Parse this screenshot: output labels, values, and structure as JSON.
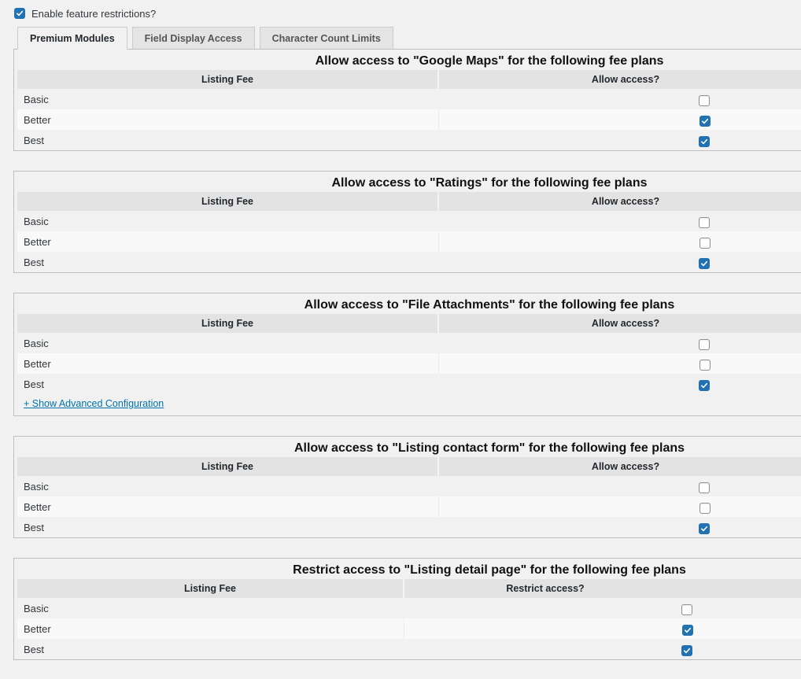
{
  "top_option": {
    "label": "Enable feature restrictions?",
    "checked": true
  },
  "tabs": [
    {
      "label": "Premium Modules",
      "active": true
    },
    {
      "label": "Field Display Access",
      "active": false
    },
    {
      "label": "Character Count Limits",
      "active": false
    }
  ],
  "panels": [
    {
      "title": "Allow access to \"Google Maps\" for the following fee plans",
      "col1": "Listing Fee",
      "col2": "Allow access?",
      "rows": [
        {
          "label": "Basic",
          "checked": false
        },
        {
          "label": "Better",
          "checked": true
        },
        {
          "label": "Best",
          "checked": true
        }
      ]
    },
    {
      "title": "Allow access to \"Ratings\" for the following fee plans",
      "col1": "Listing Fee",
      "col2": "Allow access?",
      "rows": [
        {
          "label": "Basic",
          "checked": false
        },
        {
          "label": "Better",
          "checked": false
        },
        {
          "label": "Best",
          "checked": true
        }
      ]
    },
    {
      "title": "Allow access to \"File Attachments\" for the following fee plans",
      "col1": "Listing Fee",
      "col2": "Allow access?",
      "rows": [
        {
          "label": "Basic",
          "checked": false
        },
        {
          "label": "Better",
          "checked": false
        },
        {
          "label": "Best",
          "checked": true
        }
      ],
      "link": "+ Show Advanced Configuration"
    },
    {
      "title": "Allow access to \"Listing contact form\" for the following fee plans",
      "col1": "Listing Fee",
      "col2": "Allow access?",
      "rows": [
        {
          "label": "Basic",
          "checked": false
        },
        {
          "label": "Better",
          "checked": false
        },
        {
          "label": "Best",
          "checked": true
        }
      ]
    },
    {
      "title": "Restrict access to \"Listing detail page\" for the following fee plans",
      "col1": "Listing Fee",
      "col2": "Restrict access?",
      "rows": [
        {
          "label": "Basic",
          "checked": false
        },
        {
          "label": "Better",
          "checked": true
        },
        {
          "label": "Best",
          "checked": true
        }
      ]
    }
  ]
}
